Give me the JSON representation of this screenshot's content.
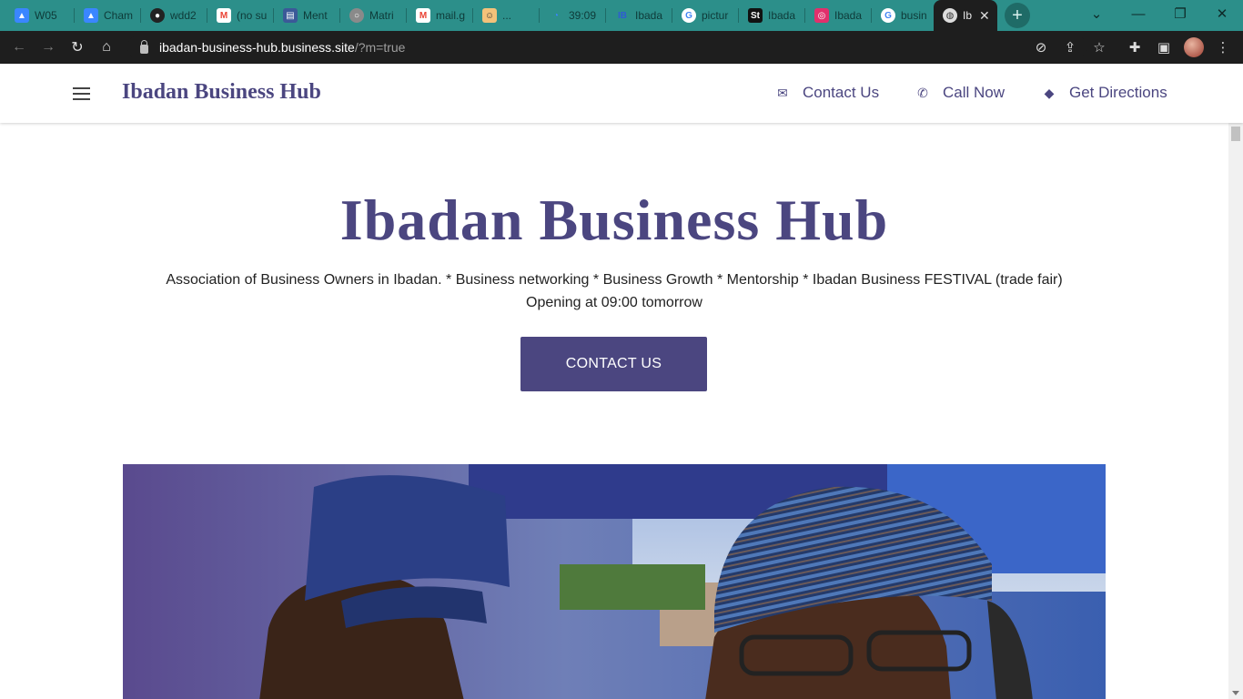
{
  "browser": {
    "tabs": [
      {
        "label": "W05",
        "icon": "chart-icon",
        "color": "#3a86ff"
      },
      {
        "label": "Cham",
        "icon": "chart-icon",
        "color": "#3a86ff"
      },
      {
        "label": "wdd2",
        "icon": "github-icon",
        "color": "#222222"
      },
      {
        "label": "(no su",
        "icon": "gmail-icon",
        "color": "#ea4335"
      },
      {
        "label": "Ment",
        "icon": "forms-icon",
        "color": "#3b5998"
      },
      {
        "label": "Matri",
        "icon": "globe-icon",
        "color": "#8a8a8a"
      },
      {
        "label": "mail.g",
        "icon": "gmail-icon",
        "color": "#ea4335"
      },
      {
        "label": "...",
        "icon": "face-icon",
        "color": "#f4c27a"
      },
      {
        "label": "39:09",
        "icon": "timer-icon",
        "color": "#3a86ff"
      },
      {
        "label": "Ibada",
        "icon": "ibh-icon",
        "color": "#2f5bd3"
      },
      {
        "label": "pictur",
        "icon": "google-icon",
        "color": "#ffffff"
      },
      {
        "label": "Ibada",
        "icon": "st-icon",
        "color": "#111111"
      },
      {
        "label": "Ibada",
        "icon": "instagram-icon",
        "color": "#e1306c"
      },
      {
        "label": "busin",
        "icon": "google-icon",
        "color": "#ffffff"
      },
      {
        "label": "Ib",
        "icon": "globe-icon",
        "color": "#dddddd"
      }
    ],
    "active_tab_close": "✕",
    "new_tab": "+",
    "url_host": "ibadan-business-hub.business.site",
    "url_path": "/?m=true"
  },
  "site": {
    "brand": "Ibadan Business Hub",
    "nav": {
      "contact": "Contact Us",
      "call": "Call Now",
      "directions": "Get Directions"
    },
    "hero_title": "Ibadan Business Hub",
    "tagline": "Association of Business Owners in Ibadan. * Business networking * Business Growth * Mentorship * Ibadan Business FESTIVAL (trade fair)",
    "hours": "Opening at 09:00 tomorrow",
    "cta": "CONTACT US"
  },
  "colors": {
    "brand": "#4b4680",
    "tabstrip": "#2c8f8a",
    "toolbar": "#1e1e1e"
  }
}
